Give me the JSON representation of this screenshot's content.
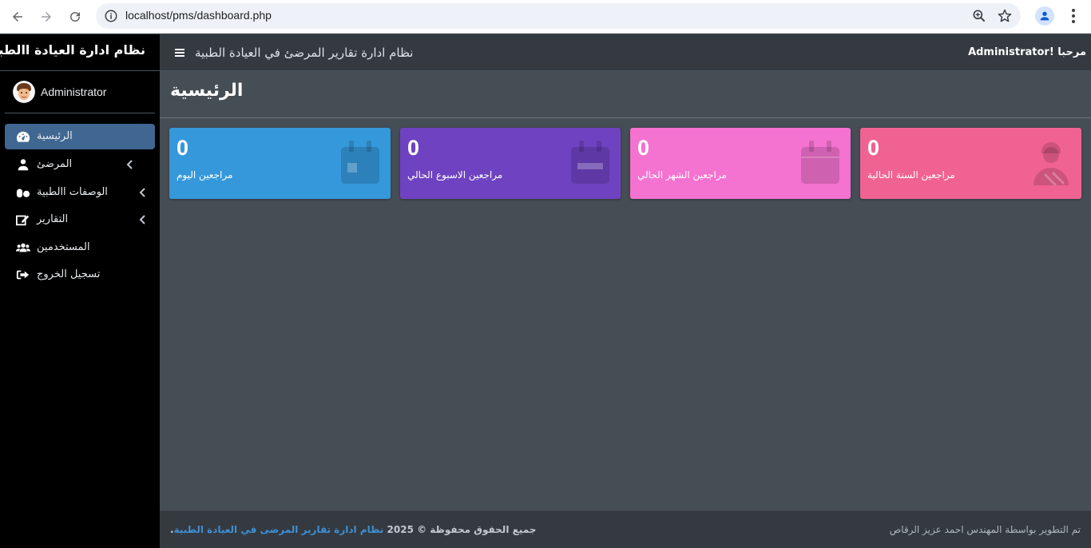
{
  "browser": {
    "url": "localhost/pms/dashboard.php"
  },
  "sidebar": {
    "brand": "نظام ادارة العيادة االطبية",
    "user": "Administrator",
    "items": [
      {
        "label": "الرئيسية",
        "icon": "tachometer-icon",
        "active": true
      },
      {
        "label": "المرضئ",
        "icon": "user-injured-icon",
        "has_children": true
      },
      {
        "label": "الوصفات االطبية",
        "icon": "pills-icon",
        "has_children": true
      },
      {
        "label": "التقارير",
        "icon": "edit-icon",
        "has_children": true
      },
      {
        "label": "المستخدمين",
        "icon": "users-icon"
      },
      {
        "label": "تسجيل الخروج",
        "icon": "sign-out-icon"
      }
    ]
  },
  "topbar": {
    "title": "نظام ادارة تقارير المرضئ في العيادة الطبية",
    "welcome": "Administrator! مرحبا"
  },
  "page": {
    "title": "الرئيسية"
  },
  "cards": [
    {
      "count": "0",
      "label": "مراجعين اليوم",
      "color": "#3498db",
      "icon": "calendar-day-icon"
    },
    {
      "count": "0",
      "label": "مراجعين الاسبوع الحالي",
      "color": "#6f42c1",
      "icon": "calendar-week-icon"
    },
    {
      "count": "0",
      "label": "مراجعين الشهر الحالي",
      "color": "#f472d0",
      "icon": "calendar-icon"
    },
    {
      "count": "0",
      "label": "مراجعين السنة الحالية",
      "color": "#f06292",
      "icon": "user-injured-icon"
    }
  ],
  "footer": {
    "rights_link": "نظام ادارة تقارير المرضى في العيادة الطبية",
    "rights_text": "جميع الحقوق محفوظة © 2025",
    "rights_suffix": ".",
    "developer": "تم التطوير بواسطة المهندس احمد عزيز الرقاص"
  }
}
